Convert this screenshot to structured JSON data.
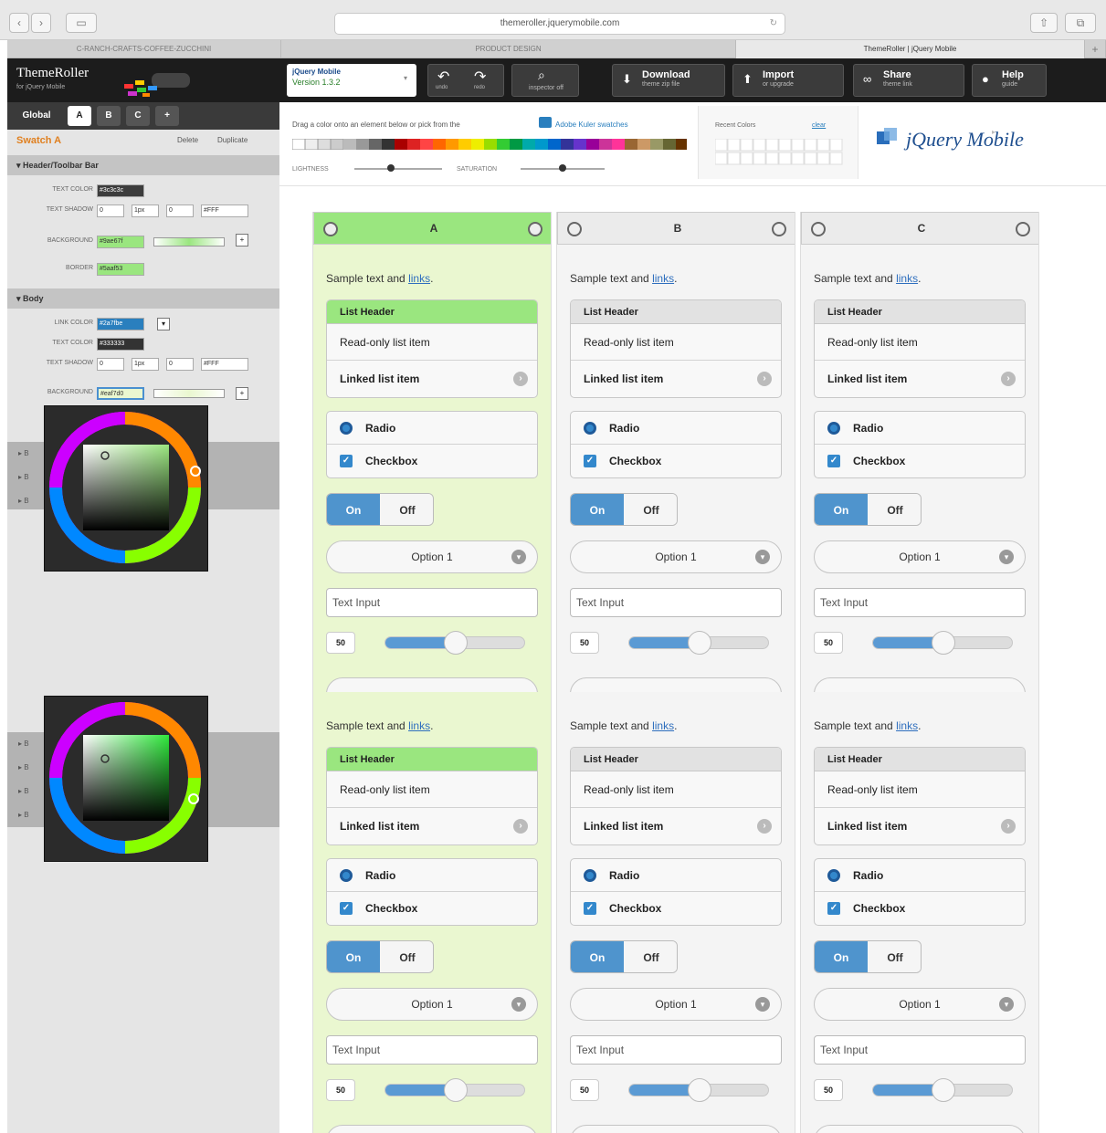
{
  "browser": {
    "url": "themeroller.jquerymobile.com",
    "tabs": [
      "C-RANCH-CRAFTS-COFFEE-ZUCCHINI",
      "PRODUCT DESIGN",
      "ThemeRoller | jQuery Mobile"
    ]
  },
  "app": {
    "logo_title": "ThemeRoller",
    "logo_subtitle": "for jQuery Mobile",
    "version_brand": "jQuery Mobile",
    "version_label": "Version 1.3.2",
    "undo_label": "undo",
    "redo_label": "redo",
    "inspector_label": "inspector off",
    "download": {
      "title": "Download",
      "sub": "theme zip file"
    },
    "import": {
      "title": "Import",
      "sub": "or upgrade"
    },
    "share": {
      "title": "Share",
      "sub": "theme link"
    },
    "help": {
      "title": "Help",
      "sub": "guide"
    }
  },
  "panel": {
    "tabs": [
      "Global",
      "A",
      "B",
      "C",
      "+"
    ],
    "swatch_title": "Swatch A",
    "delete_label": "Delete",
    "duplicate_label": "Duplicate",
    "header_section": "Header/Toolbar Bar",
    "text_color_label": "TEXT COLOR",
    "text_color_value": "#3c3c3c",
    "text_shadow_label": "TEXT SHADOW",
    "shadow_values": [
      "0",
      "1px",
      "0",
      "#FFF"
    ],
    "background_label": "BACKGROUND",
    "background_value": "#9ae67f",
    "border_label": "BORDER",
    "border_value": "#5aaf53",
    "body_section": "Body",
    "link_color_label": "LINK COLOR",
    "link_color_value": "#2a7fbe",
    "body_text_color_label": "TEXT COLOR",
    "body_text_color_value": "#333333",
    "body_shadow_label": "TEXT SHADOW",
    "body_shadow_values": [
      "0",
      "1px",
      "0",
      "#FFF"
    ],
    "body_background_label": "BACKGROUND",
    "body_background_value": "#eaf7d0"
  },
  "palette": {
    "instructions": "Drag a color onto an element below or pick from the",
    "adobe_link": "Adobe Kuler swatches",
    "lightness_label": "LIGHTNESS",
    "saturation_label": "SATURATION",
    "recent_label": "Recent Colors",
    "recent_link": "clear"
  },
  "swatches": [
    {
      "letter": "A",
      "sample": "Sample text and",
      "link": "links",
      "list_header": "List Header",
      "readonly": "Read-only list item",
      "linked": "Linked list item",
      "radio": "Radio",
      "checkbox": "Checkbox",
      "on": "On",
      "off": "Off",
      "option": "Option 1",
      "input_placeholder": "Text Input",
      "slider_value": "50",
      "slider_fraction": 0.5
    },
    {
      "letter": "B",
      "sample": "Sample text and",
      "link": "links",
      "list_header": "List Header",
      "readonly": "Read-only list item",
      "linked": "Linked list item",
      "radio": "Radio",
      "checkbox": "Checkbox",
      "on": "On",
      "off": "Off",
      "option": "Option 1",
      "input_placeholder": "Text Input",
      "slider_value": "50",
      "slider_fraction": 0.5
    },
    {
      "letter": "C",
      "sample": "Sample text and",
      "link": "links",
      "list_header": "List Header",
      "readonly": "Read-only list item",
      "linked": "Linked list item",
      "radio": "Radio",
      "checkbox": "Checkbox",
      "on": "On",
      "off": "Off",
      "option": "Option 1",
      "input_placeholder": "Text Input",
      "slider_value": "50",
      "slider_fraction": 0.5
    }
  ],
  "colors": {
    "accent_green": "#9ae67f",
    "body_green": "#eaf7d0",
    "blue": "#4f94cd",
    "toolbar": "#1c1c1c"
  },
  "jquery_logo": "jQuery Mobile"
}
